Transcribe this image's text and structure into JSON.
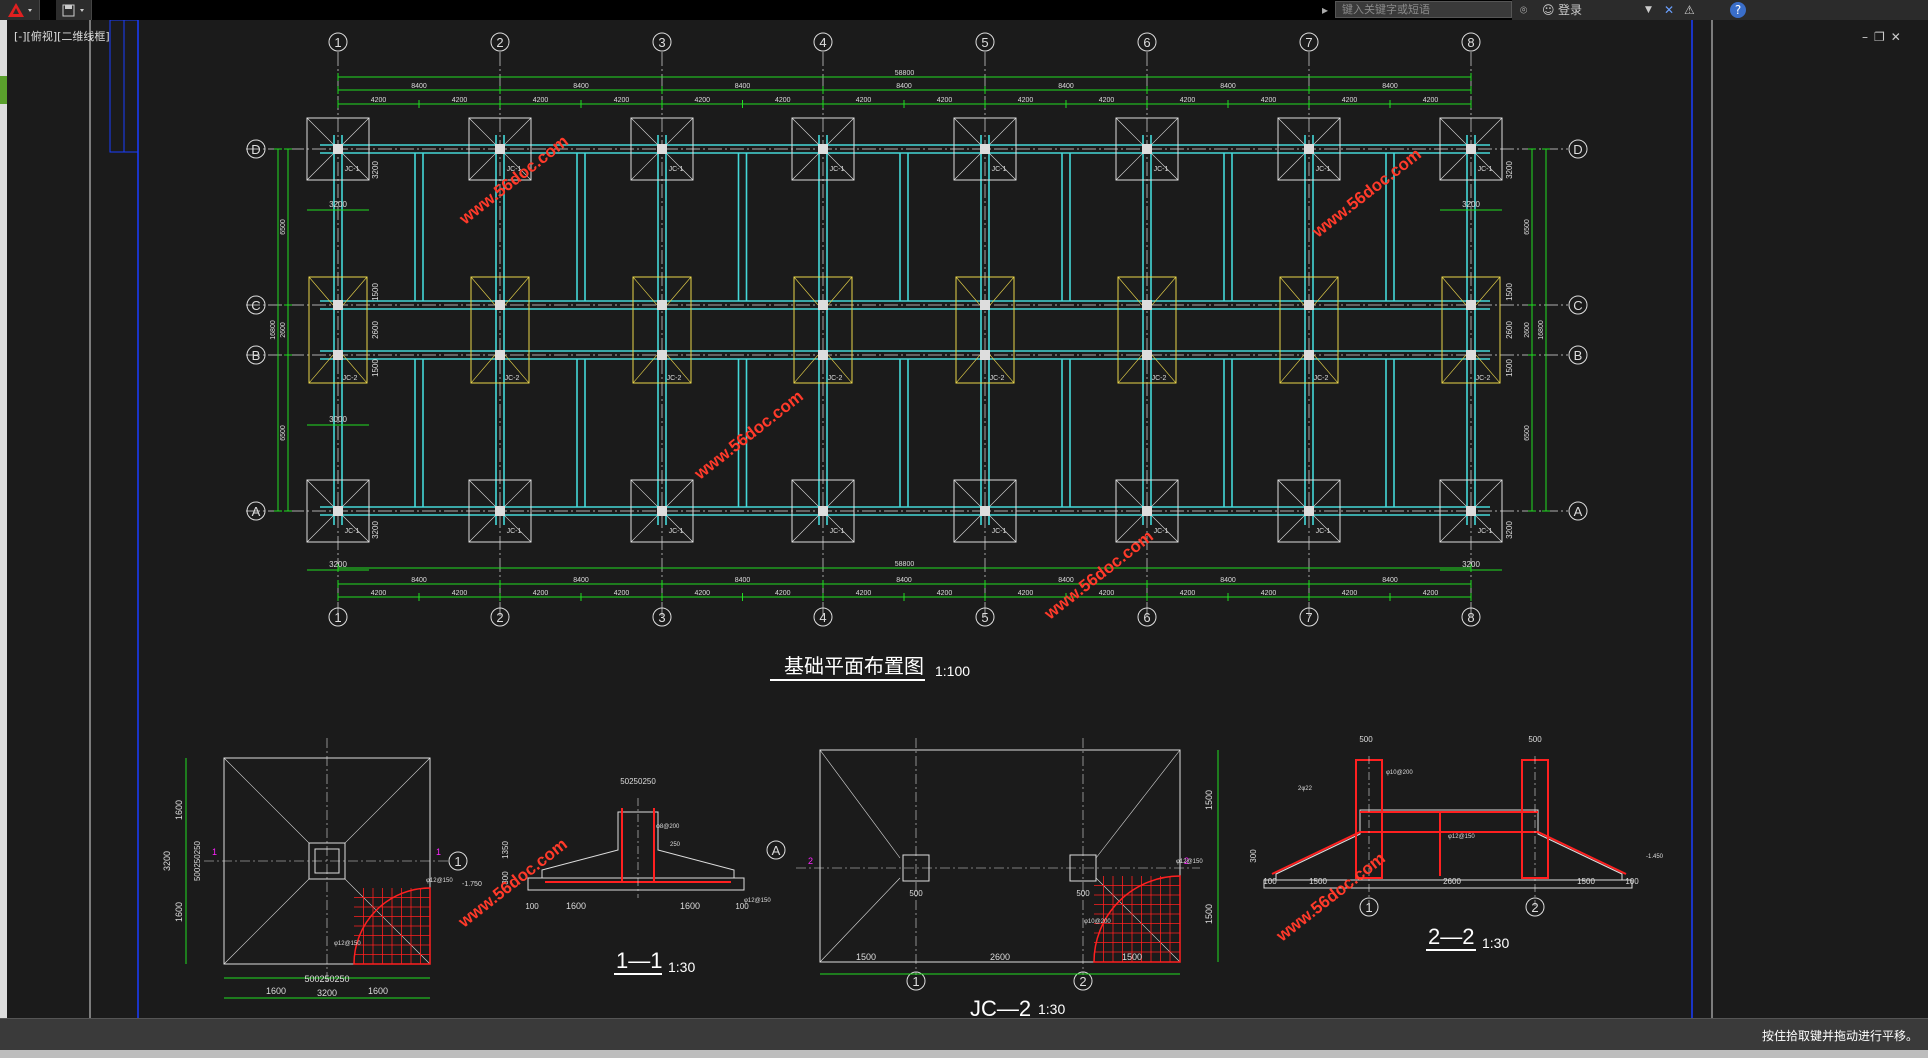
{
  "app": {
    "search_placeholder": "键入关键字或短语",
    "login_label": "登录",
    "file_tab": "[-][俯视][二维线框]",
    "status_text": "按住拾取键并拖动进行平移。"
  },
  "drawing": {
    "main_title": "基础平面布置图",
    "main_scale": "1:100",
    "watermark": "www.56doc.com",
    "sections": [
      {
        "title": "1—1",
        "scale": "1:30"
      },
      {
        "title": "JC—2",
        "scale": "1:30"
      },
      {
        "title": "2—2",
        "scale": "1:30"
      }
    ],
    "axes_numbers": [
      "1",
      "2",
      "3",
      "4",
      "5",
      "6",
      "7",
      "8"
    ],
    "axes_letters": [
      "D",
      "C",
      "B",
      "A"
    ],
    "dim_total": "58800",
    "dim_span": "8400",
    "dim_half": "4200",
    "dim_side_top": "6500",
    "dim_side_mid": "2600",
    "dim_side_bottom": "6500",
    "dim_side_total": "16800",
    "footing_jc1": "JC-1",
    "footing_jc2": "JC-2",
    "dim_3200": "3200",
    "dim_3000": "3000",
    "dim_1500": "1500",
    "dim_2600": "2600",
    "detail_dims": {
      "d1600": "1600",
      "d3200": "3200",
      "d500": "500",
      "d100": "100",
      "d2600": "2600",
      "d1500": "1500",
      "d1350": "1350",
      "d300": "300",
      "d250": "250",
      "elev_minus": "-1.750",
      "elev_minus2": "-1.450",
      "d_mix": "500250250",
      "d_mix2": "50250250",
      "label_2k22": "2φ22",
      "label_c12": "φ12@150",
      "label_c10": "φ10@200",
      "label_c8": "φ8@200",
      "label_c12b": "φ12@150"
    }
  }
}
